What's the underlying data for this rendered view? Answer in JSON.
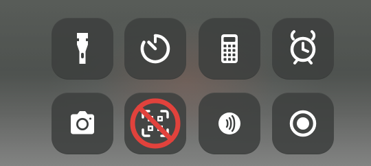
{
  "screen": {
    "controls": {
      "row_1": [
        {
          "name": "flashlight",
          "icon": "flashlight-icon"
        },
        {
          "name": "timer",
          "icon": "timer-icon"
        },
        {
          "name": "calculator",
          "icon": "calculator-icon"
        },
        {
          "name": "alarm",
          "icon": "alarm-clock-icon"
        }
      ],
      "row_2": [
        {
          "name": "camera",
          "icon": "camera-icon"
        },
        {
          "name": "qr-code-scanner",
          "icon": "qr-code-scanner-icon",
          "overlay": "prohibited-icon"
        },
        {
          "name": "nfc",
          "icon": "nfc-icon"
        },
        {
          "name": "screen-recording",
          "icon": "record-icon"
        }
      ]
    },
    "colors": {
      "tile": "#3c3f3e",
      "icon": "#ffffff",
      "prohibited": "#e1423c"
    }
  }
}
